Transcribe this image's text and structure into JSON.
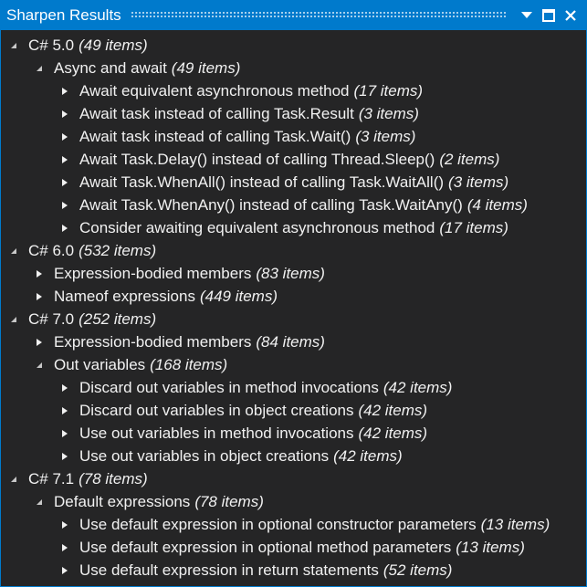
{
  "window": {
    "title": "Sharpen Results",
    "accent_color": "#007acc",
    "background_color": "#252526",
    "text_color": "#f1f1f1",
    "buttons": [
      {
        "name": "dropdown",
        "icon": "chevron-down-icon"
      },
      {
        "name": "maximize",
        "icon": "maximize-icon"
      },
      {
        "name": "close",
        "icon": "close-icon"
      }
    ]
  },
  "tree": [
    {
      "label": "C# 5.0",
      "count": "(49 items)",
      "expanded": true,
      "children": [
        {
          "label": "Async and await",
          "count": "(49 items)",
          "expanded": true,
          "children": [
            {
              "label": "Await equivalent asynchronous method",
              "count": "(17 items)"
            },
            {
              "label": "Await task instead of calling Task.Result",
              "count": "(3 items)"
            },
            {
              "label": "Await task instead of calling Task.Wait()",
              "count": "(3 items)"
            },
            {
              "label": "Await Task.Delay() instead of calling Thread.Sleep()",
              "count": "(2 items)"
            },
            {
              "label": "Await Task.WhenAll() instead of calling Task.WaitAll()",
              "count": "(3 items)"
            },
            {
              "label": "Await Task.WhenAny() instead of calling Task.WaitAny()",
              "count": "(4 items)"
            },
            {
              "label": "Consider awaiting equivalent asynchronous method",
              "count": "(17 items)"
            }
          ]
        }
      ]
    },
    {
      "label": "C# 6.0",
      "count": "(532 items)",
      "expanded": true,
      "children": [
        {
          "label": "Expression-bodied members",
          "count": "(83 items)",
          "expanded": false
        },
        {
          "label": "Nameof expressions",
          "count": "(449 items)",
          "expanded": false
        }
      ]
    },
    {
      "label": "C# 7.0",
      "count": "(252 items)",
      "expanded": true,
      "children": [
        {
          "label": "Expression-bodied members",
          "count": "(84 items)",
          "expanded": false
        },
        {
          "label": "Out variables",
          "count": "(168 items)",
          "expanded": true,
          "children": [
            {
              "label": "Discard out variables in method invocations",
              "count": "(42 items)"
            },
            {
              "label": "Discard out variables in object creations",
              "count": "(42 items)"
            },
            {
              "label": "Use out variables in method invocations",
              "count": "(42 items)"
            },
            {
              "label": "Use out variables in object creations",
              "count": "(42 items)"
            }
          ]
        }
      ]
    },
    {
      "label": "C# 7.1",
      "count": "(78 items)",
      "expanded": true,
      "children": [
        {
          "label": "Default expressions",
          "count": "(78 items)",
          "expanded": true,
          "children": [
            {
              "label": "Use default expression in optional constructor parameters",
              "count": "(13 items)"
            },
            {
              "label": "Use default expression in optional method parameters",
              "count": "(13 items)"
            },
            {
              "label": "Use default expression in return statements",
              "count": "(52 items)"
            }
          ]
        }
      ]
    }
  ]
}
